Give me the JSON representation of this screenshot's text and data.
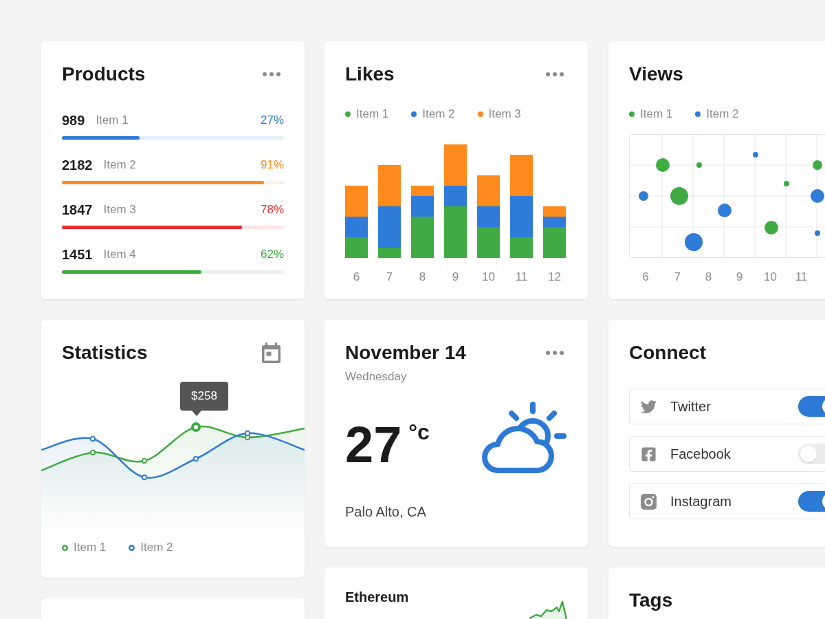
{
  "products": {
    "title": "Products",
    "items": [
      {
        "count": "989",
        "label": "Item 1",
        "percent": "27%",
        "level": 0.35,
        "color": "#2d7ad6"
      },
      {
        "count": "2182",
        "label": "Item 2",
        "percent": "91%",
        "level": 0.91,
        "color": "#fd8a1f"
      },
      {
        "count": "1847",
        "label": "Item 3",
        "percent": "78%",
        "level": 0.81,
        "color": "#ee2b2b"
      },
      {
        "count": "1451",
        "label": "Item 4",
        "percent": "62%",
        "level": 0.63,
        "color": "#3aa83d"
      }
    ]
  },
  "likes": {
    "title": "Likes",
    "legend": [
      {
        "label": "Item 1",
        "color": "#41ab43"
      },
      {
        "label": "Item 2",
        "color": "#2f7bd8"
      },
      {
        "label": "Item 3",
        "color": "#fe8a1c"
      }
    ],
    "x_labels": [
      "6",
      "7",
      "8",
      "9",
      "10",
      "11",
      "12"
    ]
  },
  "views": {
    "title": "Views",
    "legend": [
      {
        "label": "Item 1",
        "color": "#41ab43"
      },
      {
        "label": "Item 2",
        "color": "#2f7bd8"
      }
    ],
    "x_labels": [
      "6",
      "7",
      "8",
      "9",
      "10",
      "11"
    ]
  },
  "statistics": {
    "title": "Statistics",
    "tooltip": "$258",
    "legend": [
      {
        "label": "Item 1",
        "color": "#41ab43"
      },
      {
        "label": "Item 2",
        "color": "#2f7bd8"
      }
    ]
  },
  "weather": {
    "date": "November 14",
    "weekday": "Wednesday",
    "temperature": "27",
    "unit": "°c",
    "location": "Palo Alto, CA"
  },
  "connect": {
    "title": "Connect",
    "items": [
      {
        "label": "Twitter",
        "on": true
      },
      {
        "label": "Facebook",
        "on": false
      },
      {
        "label": "Instagram",
        "on": true
      }
    ]
  },
  "ethereum": {
    "title": "Ethereum"
  },
  "tags": {
    "title": "Tags"
  }
}
